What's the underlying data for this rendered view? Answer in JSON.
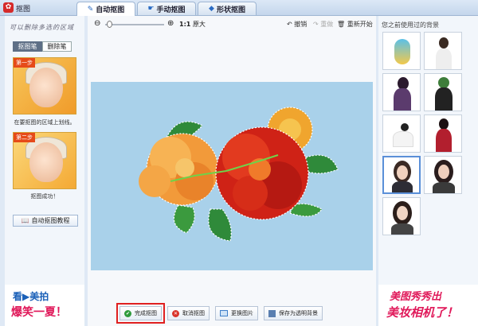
{
  "window": {
    "title": "抠图",
    "app_icon": "meitu-logo-icon"
  },
  "tabs": [
    {
      "label": "自动抠图",
      "icon": "brush-icon",
      "active": true
    },
    {
      "label": "手动抠图",
      "icon": "hand-icon",
      "active": false
    },
    {
      "label": "形状抠图",
      "icon": "shape-icon",
      "active": false
    }
  ],
  "left_panel": {
    "hint": "可以删除多选的区域",
    "pens": {
      "pick": "抠图笔",
      "erase": "删除笔",
      "selected": "pick"
    },
    "step1": {
      "badge": "第一步",
      "caption": "在要抠图的区域上划线。"
    },
    "step2": {
      "badge": "第二步",
      "caption": "抠图成功！"
    },
    "tutorial_button": "自动抠图教程",
    "ad": {
      "line1": "看▶美拍",
      "line2": "爆笑一夏！"
    }
  },
  "toolbar": {
    "ratio_bold": "1:1",
    "ratio_label": "原大",
    "undo": "撤销",
    "redo": "重做",
    "restart": "重新开始"
  },
  "actions": {
    "done": "完成抠图",
    "cancel": "取消抠图",
    "replace": "更换图片",
    "save_transparent": "保存为透明背景"
  },
  "right_panel": {
    "recent_label": "您之前使用过的背景",
    "ad": {
      "line1": "美图秀秀出",
      "line2": "美妆相机了！"
    }
  },
  "colors": {
    "canvas_bg": "#a9d1ea",
    "accent_red": "#e02020",
    "tab_blue": "#2b6cc4"
  }
}
